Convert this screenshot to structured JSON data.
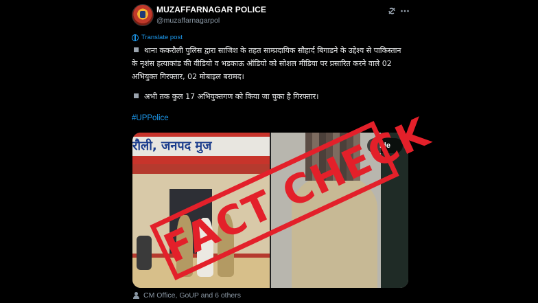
{
  "post": {
    "author_name": "MUZAFFARNAGAR POLICE",
    "author_handle": "@muzaffarnagarpol",
    "translate_label": "Translate post",
    "paragraph_1": "थाना ककरौली पुलिस द्वारा साजिश के तहत साम्प्रदायिक सौहार्द बिगाडने के उद्देश्य से पाकिस्तान के नृशंस हत्याकांड की वीडियो व भडकाऊ ऑडियो को सोशल मीडिया पर प्रसारित करने वाले 02 अभियुक्त गिरफ्तार, 02 मोबाइल बरामद।",
    "paragraph_2": "अभी तक कुल 17 अभियुक्तगण को किया जा चुका है गिरफ्तार।",
    "hashtag": "#UPPolice",
    "tagged_people": "CM Office, GoUP and 6 others"
  },
  "media": {
    "left_sign_text": "रौली, जनपद मुज",
    "hide_button_label": "ide"
  },
  "overlay": {
    "stamp_text": "FACT CHECK",
    "stamp_color": "#e3202a"
  },
  "icons": {
    "grok": "grok-icon",
    "more": "more-icon",
    "globe": "globe-icon",
    "person": "person-tag-icon"
  },
  "colors": {
    "background": "#000000",
    "link": "#1d9bf0",
    "muted": "#8b98a5"
  }
}
